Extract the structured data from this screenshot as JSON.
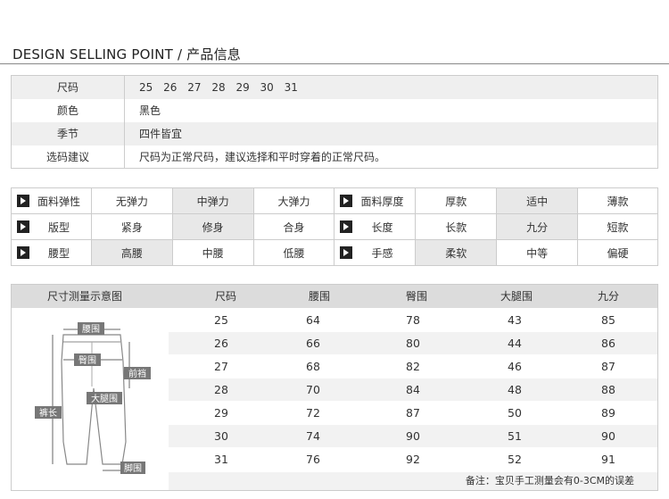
{
  "header": {
    "title": "DESIGN SELLING POINT / 产品信息"
  },
  "info": [
    {
      "label": "尺码",
      "value": "",
      "sizes": [
        "25",
        "26",
        "27",
        "28",
        "29",
        "30",
        "31"
      ]
    },
    {
      "label": "颜色",
      "value": "黑色"
    },
    {
      "label": "季节",
      "value": "四件皆宜"
    },
    {
      "label": "选码建议",
      "value": "尺码为正常尺码，建议选择和平时穿着的正常尺码。"
    }
  ],
  "properties": [
    {
      "label": "面料弹性",
      "options": [
        "无弹力",
        "中弹力",
        "大弹力"
      ],
      "selected": 1,
      "label2": "面料厚度",
      "options2": [
        "厚款",
        "适中",
        "薄款"
      ],
      "selected2": 1
    },
    {
      "label": "版型",
      "options": [
        "紧身",
        "修身",
        "合身"
      ],
      "selected": 1,
      "label2": "长度",
      "options2": [
        "长款",
        "九分",
        "短款"
      ],
      "selected2": 1
    },
    {
      "label": "腰型",
      "options": [
        "高腰",
        "中腰",
        "低腰"
      ],
      "selected": 0,
      "label2": "手感",
      "options2": [
        "柔软",
        "中等",
        "偏硬"
      ],
      "selected2": 0
    }
  ],
  "size_table": {
    "diagram_title": "尺寸测量示意图",
    "headers": [
      "尺码",
      "腰围",
      "臀围",
      "大腿围",
      "九分"
    ],
    "rows": [
      [
        "25",
        "64",
        "78",
        "43",
        "85"
      ],
      [
        "26",
        "66",
        "80",
        "44",
        "86"
      ],
      [
        "27",
        "68",
        "82",
        "46",
        "87"
      ],
      [
        "28",
        "70",
        "84",
        "48",
        "88"
      ],
      [
        "29",
        "72",
        "87",
        "50",
        "89"
      ],
      [
        "30",
        "74",
        "90",
        "51",
        "90"
      ],
      [
        "31",
        "76",
        "92",
        "52",
        "91"
      ]
    ],
    "diagram_labels": {
      "waist": "腰围",
      "hip": "臀围",
      "rise": "前裆",
      "thigh": "大腿围",
      "length": "裤长",
      "hem": "脚围"
    },
    "note": "备注：宝贝手工测量会有0-3CM的误差"
  }
}
